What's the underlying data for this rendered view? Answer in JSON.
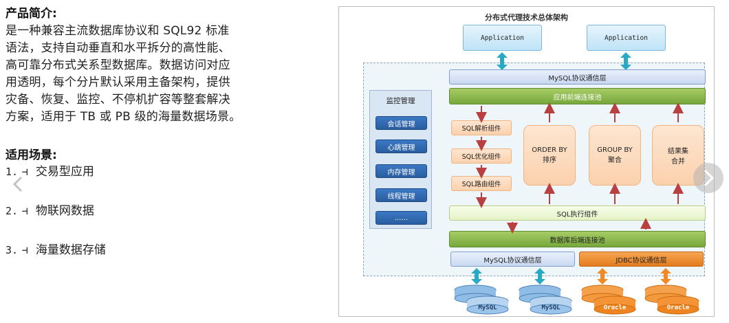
{
  "intro": {
    "heading": "产品简介:",
    "lines": [
      "是一种兼容主流数据库协议和   SQL92 标准",
      "语法，支持自动垂直和水平拆分的高性能、",
      "高可靠分布式关系型数据库。数据访问对应",
      "用透明，每个分片默认采用主备架构，提供",
      "灾备、恢复、监控、不停机扩容等整套解决",
      "方案，适用于 TB 或 PB 级的海量数据场景。"
    ]
  },
  "scenarios": {
    "heading": "适用场景:",
    "items": [
      {
        "num": "1.",
        "mark": "⊣",
        "label": "交易型应用"
      },
      {
        "num": "2.",
        "mark": "⊣",
        "label": "物联网数据"
      },
      {
        "num": "3.",
        "mark": "⊣",
        "label": "海量数据存储"
      }
    ]
  },
  "diagram": {
    "title": "分布式代理技术总体架构",
    "app_left": "Application",
    "app_right": "Application",
    "mysql_proto_top": "MySQL协议通信层",
    "front_pool": "应用前端连接池",
    "monitor": {
      "title": "监控管理",
      "items": [
        "会话管理",
        "心跳管理",
        "内存管理",
        "线程管理",
        "......"
      ]
    },
    "sql_parse": "SQL解析组件",
    "sql_opt": "SQL优化组件",
    "sql_route": "SQL路由组件",
    "order_by": [
      "ORDER BY",
      "排序"
    ],
    "group_by": [
      "GROUP BY",
      "聚合"
    ],
    "result_merge": [
      "结果集",
      "合并"
    ],
    "sql_exec": "SQL执行组件",
    "backend_pool": "数据库后端连接池",
    "mysql_proto_bottom": "MySQL协议通信层",
    "jdbc_proto": "JDBC协议通信层",
    "db_mysql_1": "MySQL",
    "db_mysql_2": "MySQL",
    "db_oracle_1": "Oracle",
    "db_oracle_2": "Oracle"
  },
  "colors": {
    "teal_arrow": "#2aa9c7",
    "orange_arrow": "#f18a25",
    "red_arrow": "#b84040",
    "mysql_db": "#6fa8dc",
    "oracle_db": "#f08a1c"
  },
  "nav": {
    "prev_icon": "chevron-left-icon",
    "next_icon": "chevron-right-icon"
  }
}
